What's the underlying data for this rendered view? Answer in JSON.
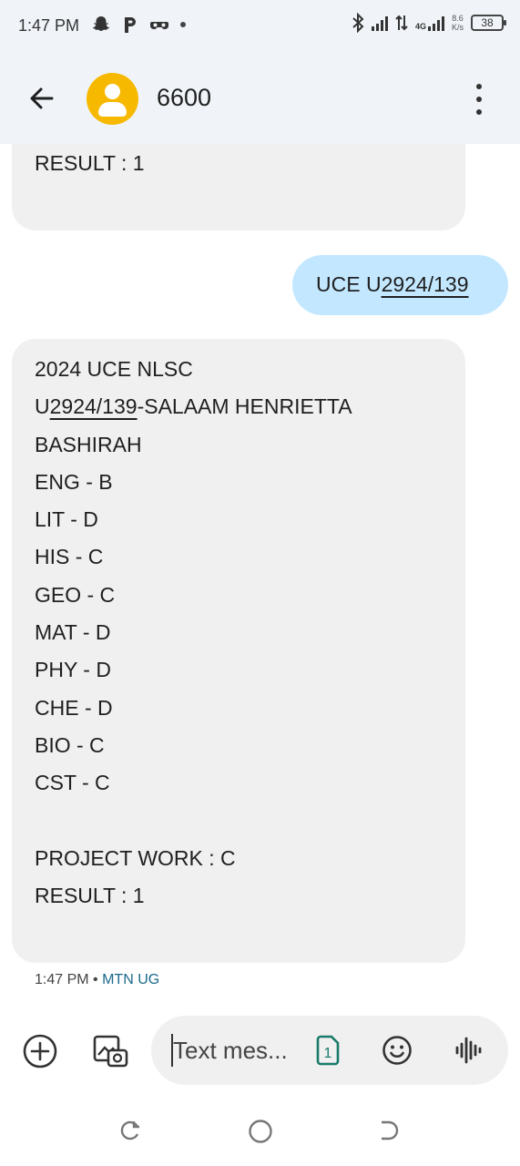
{
  "status_bar": {
    "time": "1:47 PM",
    "icons": [
      "snapchat-icon",
      "p-icon",
      "binoculars-icon",
      "dot-icon"
    ],
    "right_icons": [
      "bluetooth-icon",
      "signal-icon",
      "data-arrows-icon",
      "4g-signal-icon"
    ],
    "net_speed_value": "8.6",
    "net_speed_unit": "K/s",
    "battery": "38"
  },
  "header": {
    "contact": "6600"
  },
  "messages": {
    "top_partial": "RESULT : 1",
    "outgoing_prefix": "UCE U",
    "outgoing_link": "2924/139",
    "incoming": {
      "line1": "2024 UCE NLSC",
      "line2_prefix": "U",
      "line2_link": "2924/139",
      "line2_suffix": "-SALAAM HENRIETTA",
      "line3": "BASHIRAH",
      "grades": [
        "ENG - B",
        "LIT - D",
        "HIS - C",
        "GEO - C",
        "MAT - D",
        "PHY - D",
        "CHE - D",
        "BIO - C",
        "CST - C"
      ],
      "project": "PROJECT WORK : C",
      "result": "RESULT : 1"
    },
    "timestamp": "1:47 PM",
    "carrier": "MTN UG"
  },
  "composer": {
    "placeholder": "Text mes...",
    "sim_slot": "1"
  },
  "colors": {
    "header_bg": "#f0f4f9",
    "incoming_bubble": "#f0f0f0",
    "outgoing_bubble": "#c2e7ff",
    "avatar": "#f6b900",
    "sim_accent": "#1a7a6a"
  }
}
